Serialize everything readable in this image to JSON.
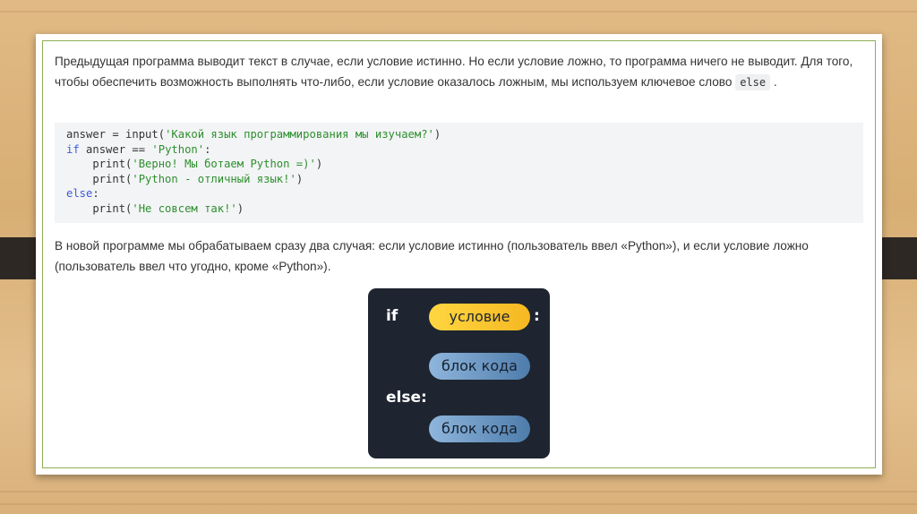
{
  "paragraph1": {
    "text_before": "Предыдущая программа выводит текст в случае, если условие истинно. Но если условие ложно, то программа ничего не выводит. Для того, чтобы обеспечить возможность выполнять что-либо, если условие оказалось ложным, мы используем ключевое слово ",
    "keyword": "else",
    "text_after": " ."
  },
  "code": {
    "l1_a": "answer = input(",
    "l1_s": "'Какой язык программирования мы изучаем?'",
    "l1_b": ")",
    "l2_kw": "if",
    "l2_a": " answer == ",
    "l2_s": "'Python'",
    "l2_b": ":",
    "l3_a": "    print(",
    "l3_s": "'Верно! Мы ботаем Python =)'",
    "l3_b": ")",
    "l4_a": "    print(",
    "l4_s": "'Python - отличный язык!'",
    "l4_b": ")",
    "l5_kw": "else",
    "l5_b": ":",
    "l6_a": "    print(",
    "l6_s": "'Не совсем так!'",
    "l6_b": ")"
  },
  "paragraph2": "В новой программе мы обрабатываем сразу два случая: если условие истинно (пользователь ввел «Python»), и если условие ложно (пользователь ввел что угодно, кроме «Python»).",
  "diagram": {
    "if_label": "if",
    "condition": "условие",
    "colon": ":",
    "block1": "блок кода",
    "else_label": "else:",
    "block2": "блок кода"
  },
  "colors": {
    "frame": "#8fae54",
    "diagram_bg": "#1e2530",
    "condition_pill": "#f5c832",
    "block_pill": "#6f9bc8",
    "keyword": "#3b5bd6",
    "string": "#2d8f2d"
  }
}
